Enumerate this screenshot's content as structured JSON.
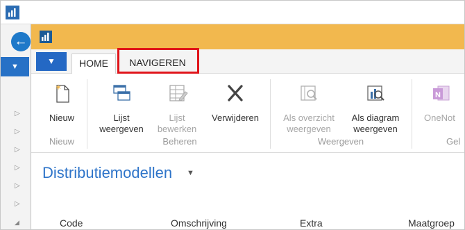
{
  "ribbon": {
    "tabs": [
      "HOME",
      "NAVIGEREN"
    ],
    "buttons": {
      "nieuw": "Nieuw",
      "lijst_weergeven_1": "Lijst",
      "lijst_weergeven_2": "weergeven",
      "lijst_bewerken_1": "Lijst",
      "lijst_bewerken_2": "bewerken",
      "verwijderen": "Verwijderen",
      "als_overzicht_1": "Als overzicht",
      "als_overzicht_2": "weergeven",
      "als_diagram_1": "Als diagram",
      "als_diagram_2": "weergeven",
      "onenote": "OneNot"
    },
    "groups": {
      "nieuw": "Nieuw",
      "beheren": "Beheren",
      "weergeven": "Weergeven",
      "gel": "Gel"
    }
  },
  "page": {
    "title": "Distributiemodellen"
  },
  "table": {
    "columns": [
      "Code",
      "Omschrijving",
      "Extra",
      "Maatgroep"
    ]
  },
  "colors": {
    "accent": "#2468c4",
    "inner_titlebar": "#f2b84e",
    "highlight": "#e0141a",
    "title": "#2e74c9"
  }
}
